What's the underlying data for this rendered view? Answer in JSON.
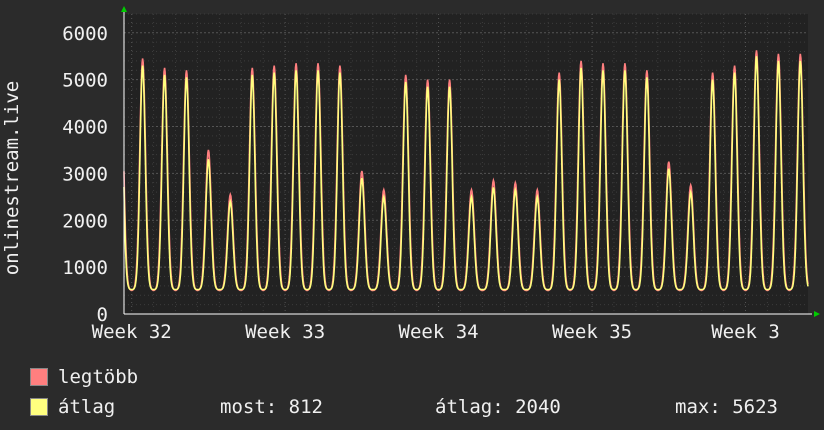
{
  "chart_data": {
    "type": "line",
    "ylabel": "onlinestream.live",
    "ylim": [
      0,
      6400
    ],
    "yticks": [
      0,
      1000,
      2000,
      3000,
      4000,
      5000,
      6000
    ],
    "yticklabels": [
      "0",
      "1000",
      "2000",
      "3000",
      "4000",
      "5000",
      "6000"
    ],
    "xticklabels": [
      "Week 32",
      "Week 33",
      "Week 34",
      "Week 35",
      "Week 3"
    ],
    "xticks_days": [
      0,
      7,
      14,
      21,
      28
    ],
    "xlim_days": [
      -0.35,
      30.85
    ],
    "grid": true,
    "daily_peaks_max": [
      5450,
      5250,
      5200,
      3500,
      2550,
      5250,
      5300,
      5350,
      5350,
      5300,
      3050,
      2650,
      5100,
      5000,
      5000,
      2650,
      2850,
      2800,
      2650,
      5150,
      5400,
      5350,
      5350,
      5200,
      3250,
      2750,
      5150,
      5300,
      5623,
      5550
    ],
    "daily_peaks_avg": [
      5300,
      5100,
      5050,
      3300,
      2400,
      5100,
      5150,
      5200,
      5200,
      5150,
      2900,
      2500,
      4950,
      4850,
      4850,
      2500,
      2700,
      2650,
      2500,
      5000,
      5250,
      5200,
      5200,
      5050,
      3100,
      2600,
      5000,
      5150,
      5500,
      5400
    ],
    "daily_trough": 500,
    "series": [
      {
        "name": "legtöbb",
        "color": "#ff7f7f"
      },
      {
        "name": "átlag",
        "color": "#ffff7f"
      }
    ],
    "stats": {
      "most": "most: 812",
      "atlag": "átlag: 2040",
      "max": "max: 5623"
    },
    "colors": {
      "background": "#2b2b2b",
      "plot_background": "#222222",
      "grid": "#3c3c3c",
      "axis": "#ffffff",
      "arrow_y": "#00cc00",
      "arrow_x": "#00cc00"
    }
  }
}
